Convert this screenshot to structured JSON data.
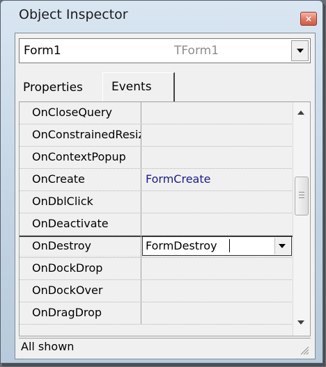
{
  "window": {
    "title": "Object Inspector",
    "close_glyph": "×"
  },
  "object_selector": {
    "name": "Form1",
    "type": "TForm1"
  },
  "tabs": [
    {
      "label": "Properties",
      "active": false
    },
    {
      "label": "Events",
      "active": true
    }
  ],
  "events": [
    {
      "name": "OnCloseQuery",
      "value": ""
    },
    {
      "name": "OnConstrainedResize",
      "value": ""
    },
    {
      "name": "OnContextPopup",
      "value": ""
    },
    {
      "name": "OnCreate",
      "value": "FormCreate"
    },
    {
      "name": "OnDblClick",
      "value": ""
    },
    {
      "name": "OnDeactivate",
      "value": ""
    },
    {
      "name": "OnDestroy",
      "value": "FormDestroy",
      "selected": true
    },
    {
      "name": "OnDockDrop",
      "value": ""
    },
    {
      "name": "OnDockOver",
      "value": ""
    },
    {
      "name": "OnDragDrop",
      "value": ""
    }
  ],
  "status": {
    "text": "All shown"
  },
  "icons": {
    "close": "close-icon",
    "dropdown": "chevron-down-icon",
    "scroll_up": "scroll-up-arrow-icon",
    "scroll_down": "scroll-down-arrow-icon",
    "resize": "resize-grip-icon"
  },
  "colors": {
    "value_text": "#1a1a8c",
    "close_button": "#e07764"
  }
}
